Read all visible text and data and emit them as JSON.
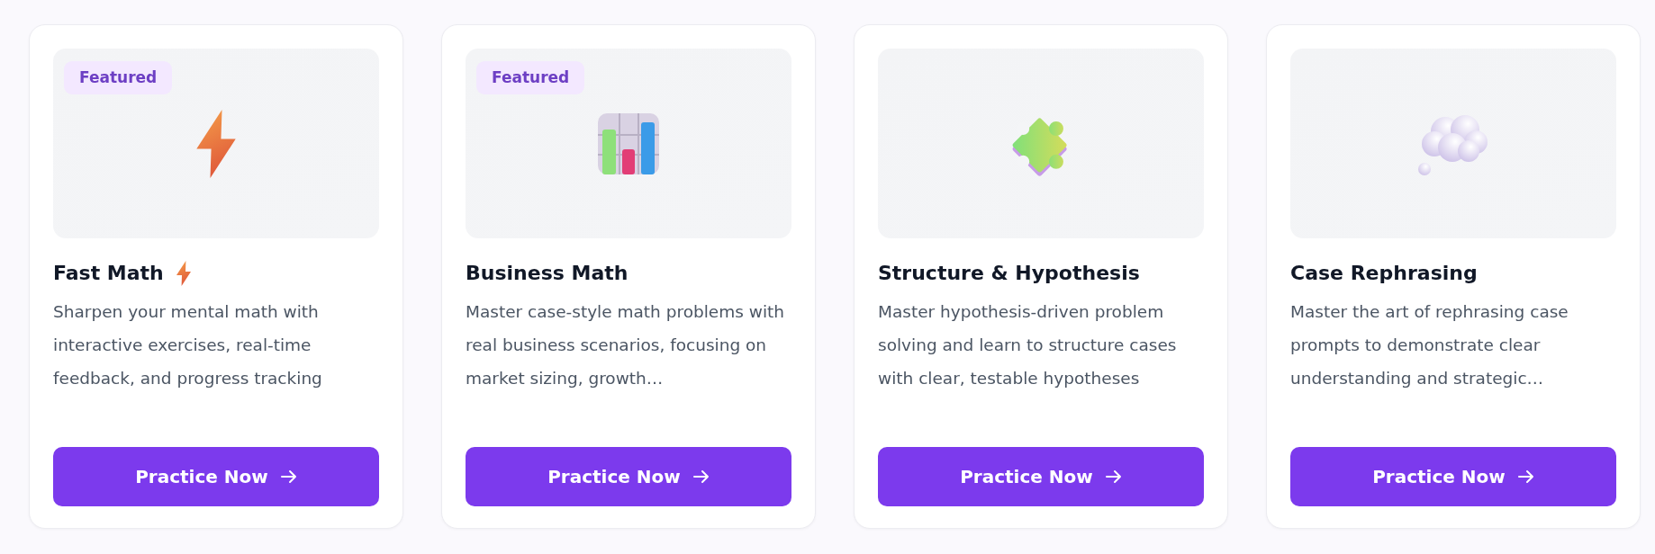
{
  "cards": [
    {
      "badge": "Featured",
      "title": "Fast Math",
      "title_icon": true,
      "description": "Sharpen your mental math with interactive exercises, real-time feedback, and progress tracking",
      "button": "Practice Now"
    },
    {
      "badge": "Featured",
      "title": "Business Math",
      "title_icon": false,
      "description": "Master case-style math problems with real business scenarios, focusing on market sizing, growth…",
      "button": "Practice Now"
    },
    {
      "title": "Structure & Hypothesis",
      "title_icon": false,
      "description": "Master hypothesis-driven problem solving and learn to structure cases with clear, testable hypotheses",
      "button": "Practice Now"
    },
    {
      "title": "Case Rephrasing",
      "title_icon": false,
      "description": "Master the art of rephrasing case prompts to demonstrate clear understanding and strategic…",
      "button": "Practice Now"
    }
  ]
}
